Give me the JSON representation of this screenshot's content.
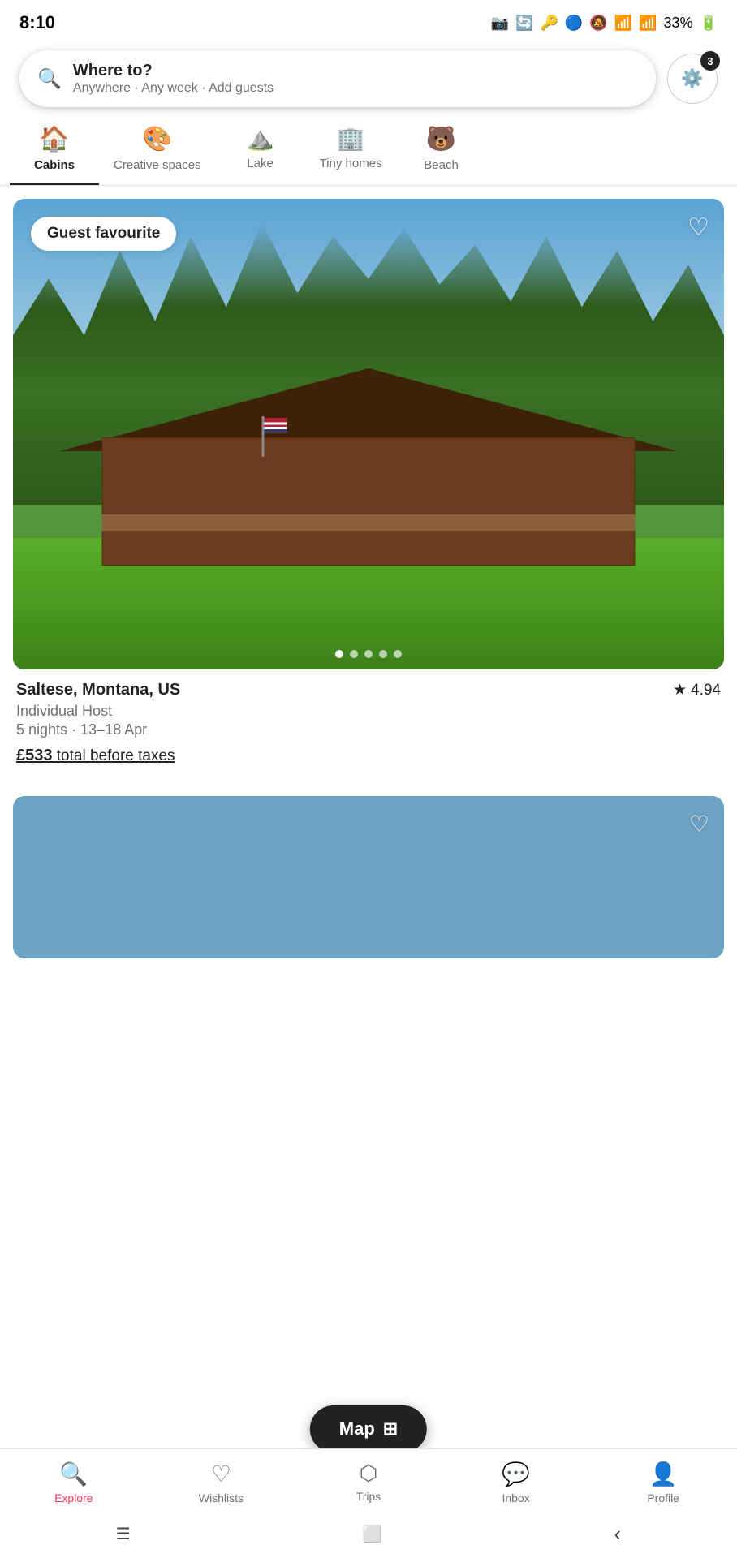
{
  "statusBar": {
    "time": "8:10",
    "batteryPercent": "33%"
  },
  "searchBar": {
    "mainText": "Where to?",
    "subText": "Anywhere · Any week · Add guests",
    "filterBadge": "3"
  },
  "categories": [
    {
      "id": "cabins",
      "label": "Cabins",
      "icon": "🏠",
      "active": true
    },
    {
      "id": "creative-spaces",
      "label": "Creative spaces",
      "icon": "🎨",
      "active": false
    },
    {
      "id": "lake",
      "label": "Lake",
      "icon": "🏔",
      "active": false
    },
    {
      "id": "tiny-homes",
      "label": "Tiny homes",
      "icon": "🏗",
      "active": false
    },
    {
      "id": "beach",
      "label": "Beach",
      "icon": "🐻",
      "active": false
    }
  ],
  "listings": [
    {
      "id": "listing-1",
      "badge": "Guest favourite",
      "location": "Saltese, Montana, US",
      "rating": "4.94",
      "host": "Individual Host",
      "nights": "5 nights · 13–18 Apr",
      "price": "£533",
      "priceSuffix": " total before taxes",
      "dots": 5,
      "activeDot": 0
    }
  ],
  "mapButton": {
    "label": "Map",
    "icon": "🗺"
  },
  "bottomNav": [
    {
      "id": "explore",
      "label": "Explore",
      "icon": "🔍",
      "active": true
    },
    {
      "id": "wishlists",
      "label": "Wishlists",
      "icon": "♡",
      "active": false
    },
    {
      "id": "trips",
      "label": "Trips",
      "icon": "⬡",
      "active": false
    },
    {
      "id": "inbox",
      "label": "Inbox",
      "icon": "💬",
      "active": false
    },
    {
      "id": "profile",
      "label": "Profile",
      "icon": "👤",
      "active": false
    }
  ],
  "androidNav": {
    "menu": "☰",
    "home": "⬜",
    "back": "‹"
  }
}
